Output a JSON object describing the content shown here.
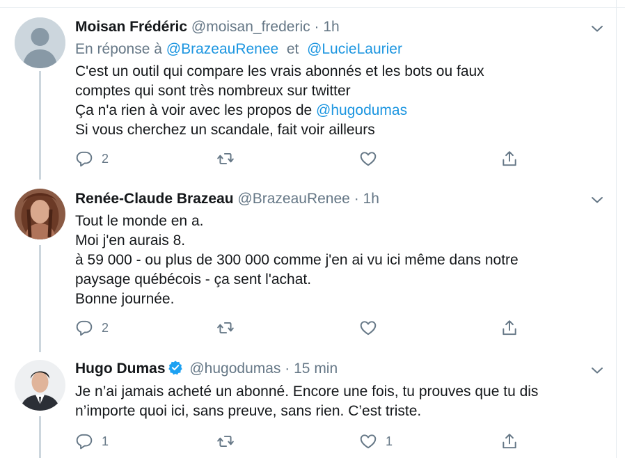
{
  "tweets": [
    {
      "name": "Moisan Frédéric",
      "handle": "@moisan_frederic",
      "separator": "·",
      "time": "1h",
      "reply_prefix": "En réponse à",
      "reply_to": [
        "@BrazeauRenee",
        "@LucieLaurier"
      ],
      "reply_join": "et",
      "lines": [
        "C'est un outil qui compare les vrais abonnés et les bots ou faux",
        "comptes qui sont très nombreux sur twitter"
      ],
      "mention_line_prefix": "Ça n'a rien à voir avec les propos de ",
      "mention": "@hugodumas",
      "last_line": "Si vous cherchez un scandale, fait voir ailleurs",
      "reply_count": "2",
      "retweet_count": "",
      "like_count": ""
    },
    {
      "name": "Renée-Claude Brazeau",
      "handle": "@BrazeauRenee",
      "separator": "·",
      "time": "1h",
      "lines": [
        "Tout le monde en a.",
        "Moi j'en aurais 8.",
        "à 59 000 - ou plus de 300 000 comme j'en ai vu ici même dans notre",
        "paysage québécois - ça sent l'achat.",
        "Bonne journée."
      ],
      "reply_count": "2",
      "retweet_count": "",
      "like_count": ""
    },
    {
      "name": "Hugo Dumas",
      "handle": "@hugodumas",
      "separator": "·",
      "time": "15 min",
      "lines": [
        "Je n’ai jamais acheté un abonné. Encore une fois, tu prouves que tu dis",
        "n’importe quoi ici, sans preuve, sans rien. C’est triste."
      ],
      "reply_count": "1",
      "retweet_count": "",
      "like_count": "1"
    }
  ],
  "colors": {
    "text": "#14171a",
    "muted": "#657786",
    "link": "#1b95e0",
    "verified": "#1da1f2",
    "thread_line": "#ccd6dd",
    "divider": "#e6ecf0"
  },
  "icons": [
    "chevron-down-icon",
    "reply-icon",
    "retweet-icon",
    "like-icon",
    "share-icon",
    "verified-badge-icon"
  ]
}
